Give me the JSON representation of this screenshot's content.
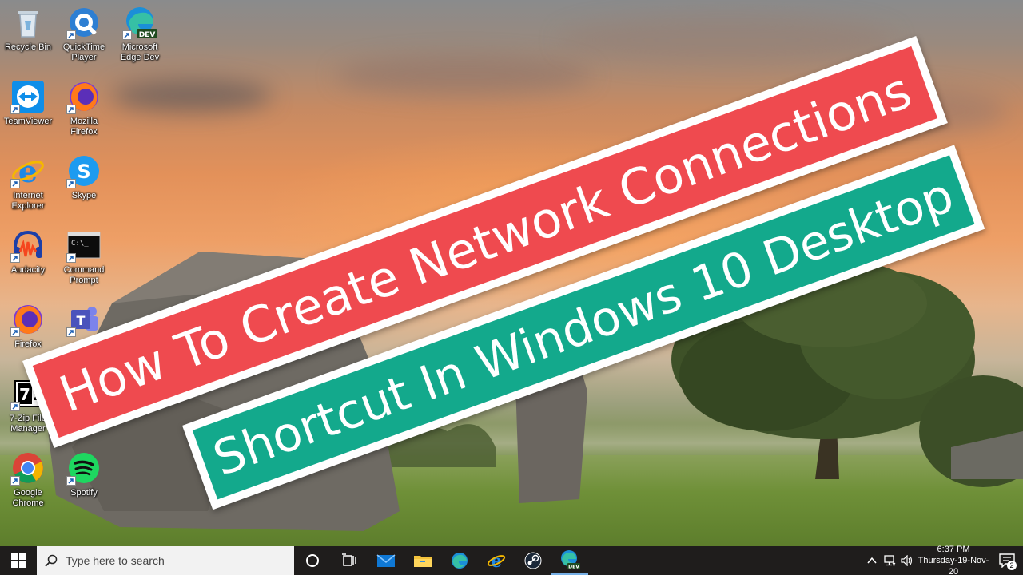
{
  "desktop": {
    "icons": [
      {
        "id": "recycle-bin",
        "label": "Recycle Bin",
        "icon": "recycle-bin-icon",
        "shortcut": false
      },
      {
        "id": "quicktime",
        "label": "QuickTime\nPlayer",
        "icon": "quicktime-icon",
        "shortcut": true
      },
      {
        "id": "edge-dev",
        "label": "Microsoft\nEdge Dev",
        "icon": "edge-dev-icon",
        "badge": "DEV",
        "shortcut": true
      },
      {
        "id": "teamviewer",
        "label": "TeamViewer",
        "icon": "teamviewer-icon",
        "shortcut": true
      },
      {
        "id": "mozilla-firefox",
        "label": "Mozilla\nFirefox",
        "icon": "firefox-icon",
        "shortcut": true
      },
      {
        "id": "internet-explorer",
        "label": "Internet\nExplorer",
        "icon": "internet-explorer-icon",
        "shortcut": true
      },
      {
        "id": "skype",
        "label": "Skype",
        "icon": "skype-icon",
        "shortcut": true
      },
      {
        "id": "audacity",
        "label": "Audacity",
        "icon": "audacity-icon",
        "shortcut": true
      },
      {
        "id": "command-prompt",
        "label": "Command\nPrompt",
        "icon": "command-prompt-icon",
        "shortcut": true
      },
      {
        "id": "firefox",
        "label": "Firefox",
        "icon": "firefox-icon",
        "shortcut": true
      },
      {
        "id": "teams",
        "label": "",
        "icon": "teams-icon",
        "shortcut": true
      },
      {
        "id": "7zip",
        "label": "7-Zip File\nManager",
        "icon": "7zip-icon",
        "shortcut": true
      },
      {
        "id": "google-chrome",
        "label": "Google\nChrome",
        "icon": "chrome-icon",
        "shortcut": true
      },
      {
        "id": "spotify",
        "label": "Spotify",
        "icon": "spotify-icon",
        "shortcut": true
      }
    ]
  },
  "banner": {
    "line1": "How To Create Network Connections",
    "line2": "Shortcut In Windows 10 Desktop",
    "colors": {
      "line1": "#ef4a4f",
      "line2": "#13a98c"
    }
  },
  "taskbar": {
    "search_placeholder": "Type here to search",
    "apps": [
      "task-view-icon",
      "mail-icon",
      "file-explorer-icon",
      "edge-icon",
      "internet-explorer-icon",
      "steam-icon",
      "edge-dev-icon"
    ],
    "clock": {
      "time": "6:37 PM",
      "date": "Thursday-19-Nov-20"
    },
    "notifications_count": "2"
  }
}
